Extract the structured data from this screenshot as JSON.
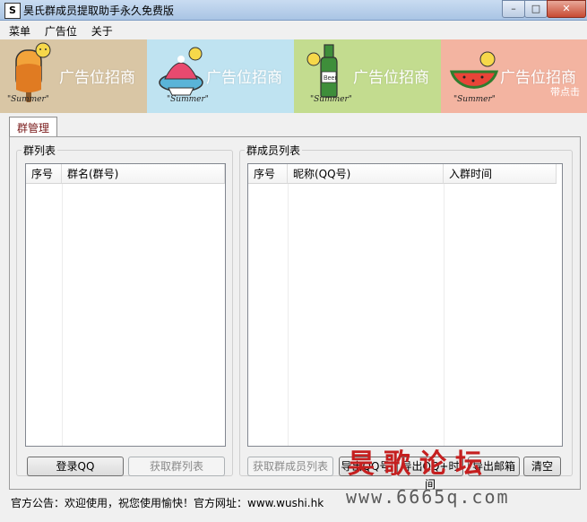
{
  "window": {
    "title": "昊氏群成员提取助手永久免费版",
    "icon": "S",
    "controls": {
      "minimize": "–",
      "maximize": "□",
      "close": "✕"
    }
  },
  "menu": [
    "菜单",
    "广告位",
    "关于"
  ],
  "banners": [
    {
      "text": "广告位招商",
      "caption": "\"Summer\"",
      "icon": "popsicle-icon",
      "bg": "#d9c6a5",
      "accent": "#f29c2b"
    },
    {
      "text": "广告位招商",
      "caption": "\"Summer\"",
      "icon": "shaved-ice-icon",
      "bg": "#bfe3f1",
      "accent": "#e84a6f"
    },
    {
      "text": "广告位招商",
      "caption": "\"Summer\"",
      "icon": "beer-bottle-icon",
      "bg": "#c3dc8f",
      "accent": "#3e8e3a"
    },
    {
      "text": "广告位招商",
      "caption": "\"Summer\"",
      "icon": "watermelon-icon",
      "bg": "#f3b4a1",
      "accent": "#e94438",
      "sub": "带点击"
    }
  ],
  "tab": "群管理",
  "group_list": {
    "legend": "群列表",
    "columns": [
      "序号",
      "群名(群号)"
    ]
  },
  "member_list": {
    "legend": "群成员列表",
    "columns": [
      "序号",
      "昵称(QQ号)",
      "入群时间"
    ]
  },
  "buttons": {
    "login": "登录QQ",
    "get_groups": "获取群列表",
    "get_members": "获取群成员列表",
    "export_qq": "导出QQ号",
    "export_qq_time": "导出QQ+时间",
    "export_email": "导出邮箱",
    "clear": "清空"
  },
  "status": "官方公告：欢迎使用，祝您使用愉快！官方网址：www.wushi.hk",
  "watermark": {
    "line1": "昊歌论坛",
    "line2": "www.6665q.com"
  }
}
